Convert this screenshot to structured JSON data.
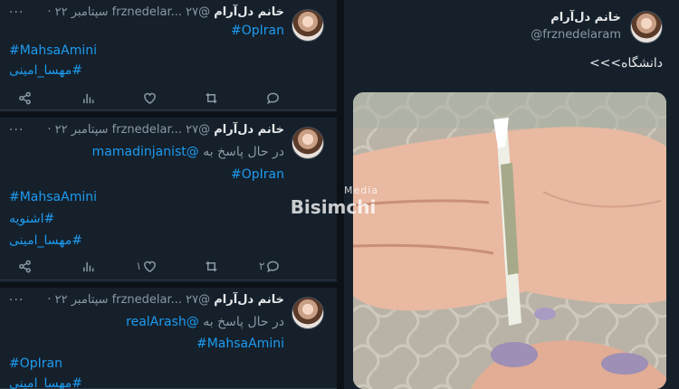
{
  "left_feed": {
    "tweets": [
      {
        "name": "خانم دل‌آرام",
        "handle": "@frznedelar...",
        "date": "۲۷ سپتامبر ۲۲ ·",
        "reply_to_prefix": "",
        "reply_to": "",
        "lines": [
          "#OpIran",
          "#MahsaAmini",
          "#مهسا_امینی"
        ],
        "actions": {
          "replies": "",
          "retweets": "",
          "likes": "",
          "views": ""
        }
      },
      {
        "name": "خانم دل‌آرام",
        "handle": "@frznedelar...",
        "date": "۲۷ سپتامبر ۲۲ ·",
        "reply_to_prefix": "در حال پاسخ به",
        "reply_to": "@mamadinjanist",
        "lines": [
          "#OpIran",
          "#MahsaAmini",
          "#اشنویه",
          "#مهسا_امینی"
        ],
        "actions": {
          "replies": "۲",
          "retweets": "",
          "likes": "۱",
          "views": ""
        }
      },
      {
        "name": "خانم دل‌آرام",
        "handle": "@frznedelar...",
        "date": "۲۷ سپتامبر ۲۲ ·",
        "reply_to_prefix": "در حال پاسخ به",
        "reply_to": "@realArash",
        "lines": [
          "#MahsaAmini",
          "#OpIran",
          "#مهسا_امینی"
        ]
      }
    ]
  },
  "right_tweet": {
    "name": "خانم دل‌آرام",
    "handle": "@frznedelaram",
    "text": "دانشگاه>>>",
    "photo_alt": "hand holding a rolled joint"
  },
  "watermark": {
    "small": "Media",
    "big": "Bisimchi"
  },
  "more_label": "···",
  "icons": [
    "more-icon",
    "reply-icon",
    "retweet-icon",
    "like-icon",
    "views-icon",
    "share-icon"
  ],
  "colors": {
    "background": "#15202b",
    "hashtag": "#1d9bf0",
    "muted": "#8b98a5",
    "text": "#e7e9ea"
  }
}
